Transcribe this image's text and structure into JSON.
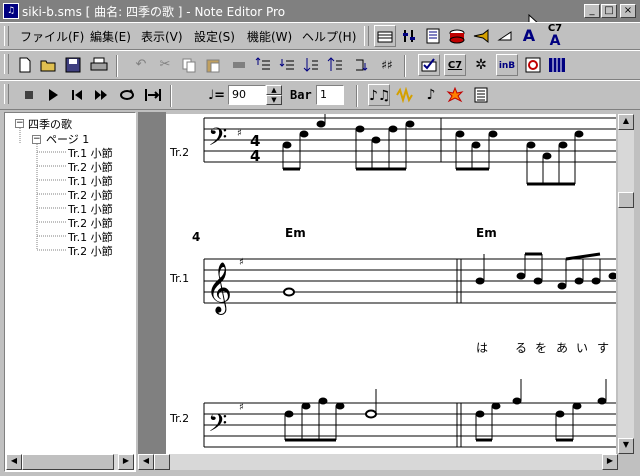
{
  "window": {
    "title": "siki-b.sms [ 曲名: 四季の歌 ] - Note Editor Pro",
    "app_icon": "note-editor-icon",
    "minimize": "_",
    "maximize": "□",
    "close": "×"
  },
  "menu": {
    "items": [
      "ファイル(F)",
      "編集(E)",
      "表示(V)",
      "設定(S)",
      "機能(W)",
      "ヘルプ(H)"
    ]
  },
  "menu_toolbar": {
    "icons": [
      "score-view-icon",
      "mixer-icon",
      "list-icon",
      "drum-icon",
      "brass-icon",
      "volume-icon",
      "text-a-icon",
      "chord-c7-icon"
    ],
    "text_a_label": "A",
    "chord_label": "C7"
  },
  "toolbar1": {
    "icons": [
      "new-file-icon",
      "open-folder-icon",
      "save-icon",
      "print-icon",
      "undo-icon",
      "cut-icon",
      "copy-icon",
      "paste-icon",
      "delete-icon",
      "insert-up-icon",
      "insert-down-icon",
      "sort-down-icon",
      "sort-up-icon",
      "transpose-icon",
      "sharp-icon",
      "check-icon",
      "chord-c7-icon",
      "sparkle-icon",
      "jnb-icon",
      "refresh-icon",
      "grid-icon"
    ],
    "chord_label": "C7",
    "tr_label": "Tr",
    "inb_label": "inB"
  },
  "transport": {
    "icons": [
      "stop-icon",
      "play-icon",
      "rewind-start-icon",
      "fast-forward-icon",
      "loop-icon",
      "repeat-icon"
    ],
    "tempo_label": "♩=",
    "tempo_value": "90",
    "bar_label": "Bar",
    "bar_value": "1",
    "extra_icons": [
      "notes-icon",
      "waveform-icon",
      "note-pencil-icon",
      "burst-icon",
      "score-list-icon"
    ]
  },
  "tree": {
    "root": "四季の歌",
    "page": "ページ 1",
    "items": [
      "Tr.1 小節",
      "Tr.2 小節",
      "Tr.1 小節",
      "Tr.2 小節",
      "Tr.1 小節",
      "Tr.2 小節",
      "Tr.1 小節",
      "Tr.2 小節"
    ]
  },
  "score": {
    "track_top": "Tr.2",
    "measure_number": "4",
    "chords": [
      "Em",
      "Em"
    ],
    "track_mid": "Tr.1",
    "lyrics": [
      "は",
      "る",
      "を",
      "あ",
      "い",
      "す"
    ],
    "track_bottom": "Tr.2",
    "time_signature_top": "4",
    "time_signature_bottom": "4"
  }
}
